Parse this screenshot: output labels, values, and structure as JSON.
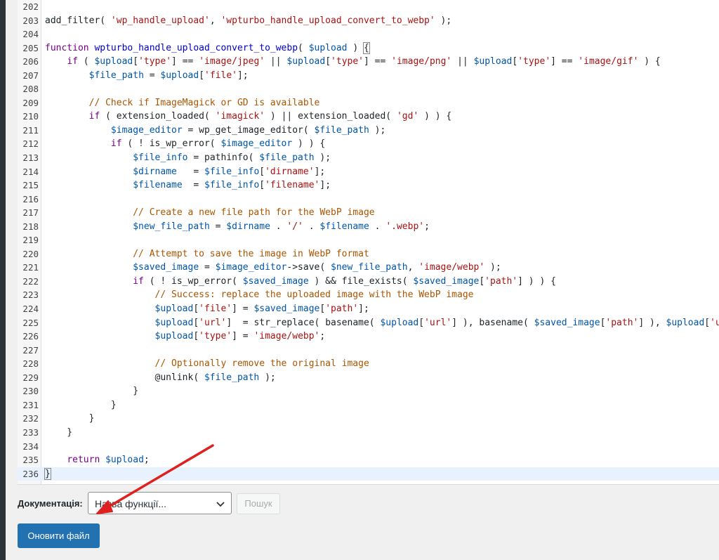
{
  "editor": {
    "lines": [
      {
        "n": "202",
        "tokens": []
      },
      {
        "n": "203",
        "tokens": [
          [
            "t-plain",
            "add_filter( "
          ],
          [
            "t-str",
            "'wp_handle_upload'"
          ],
          [
            "t-plain",
            ", "
          ],
          [
            "t-str",
            "'wpturbo_handle_upload_convert_to_webp'"
          ],
          [
            "t-plain",
            " );"
          ]
        ]
      },
      {
        "n": "204",
        "tokens": []
      },
      {
        "n": "205",
        "tokens": [
          [
            "t-kw",
            "function"
          ],
          [
            "t-plain",
            " "
          ],
          [
            "t-fn",
            "wpturbo_handle_upload_convert_to_webp"
          ],
          [
            "t-plain",
            "( "
          ],
          [
            "t-var",
            "$upload"
          ],
          [
            "t-plain",
            " ) "
          ],
          [
            "t-brace",
            "{"
          ]
        ]
      },
      {
        "n": "206",
        "tokens": [
          [
            "t-plain",
            "    "
          ],
          [
            "t-kw",
            "if"
          ],
          [
            "t-plain",
            " ( "
          ],
          [
            "t-var",
            "$upload"
          ],
          [
            "t-plain",
            "["
          ],
          [
            "t-str",
            "'type'"
          ],
          [
            "t-plain",
            "] == "
          ],
          [
            "t-str",
            "'image/jpeg'"
          ],
          [
            "t-plain",
            " || "
          ],
          [
            "t-var",
            "$upload"
          ],
          [
            "t-plain",
            "["
          ],
          [
            "t-str",
            "'type'"
          ],
          [
            "t-plain",
            "] == "
          ],
          [
            "t-str",
            "'image/png'"
          ],
          [
            "t-plain",
            " || "
          ],
          [
            "t-var",
            "$upload"
          ],
          [
            "t-plain",
            "["
          ],
          [
            "t-str",
            "'type'"
          ],
          [
            "t-plain",
            "] == "
          ],
          [
            "t-str",
            "'image/gif'"
          ],
          [
            "t-plain",
            " ) {"
          ]
        ]
      },
      {
        "n": "207",
        "tokens": [
          [
            "t-plain",
            "        "
          ],
          [
            "t-var",
            "$file_path"
          ],
          [
            "t-plain",
            " = "
          ],
          [
            "t-var",
            "$upload"
          ],
          [
            "t-plain",
            "["
          ],
          [
            "t-str",
            "'file'"
          ],
          [
            "t-plain",
            "];"
          ]
        ]
      },
      {
        "n": "208",
        "tokens": []
      },
      {
        "n": "209",
        "tokens": [
          [
            "t-plain",
            "        "
          ],
          [
            "t-com",
            "// Check if ImageMagick or GD is available"
          ]
        ]
      },
      {
        "n": "210",
        "tokens": [
          [
            "t-plain",
            "        "
          ],
          [
            "t-kw",
            "if"
          ],
          [
            "t-plain",
            " ( extension_loaded( "
          ],
          [
            "t-str",
            "'imagick'"
          ],
          [
            "t-plain",
            " ) || extension_loaded( "
          ],
          [
            "t-str",
            "'gd'"
          ],
          [
            "t-plain",
            " ) ) {"
          ]
        ]
      },
      {
        "n": "211",
        "tokens": [
          [
            "t-plain",
            "            "
          ],
          [
            "t-var",
            "$image_editor"
          ],
          [
            "t-plain",
            " = wp_get_image_editor( "
          ],
          [
            "t-var",
            "$file_path"
          ],
          [
            "t-plain",
            " );"
          ]
        ]
      },
      {
        "n": "212",
        "tokens": [
          [
            "t-plain",
            "            "
          ],
          [
            "t-kw",
            "if"
          ],
          [
            "t-plain",
            " ( ! is_wp_error( "
          ],
          [
            "t-var",
            "$image_editor"
          ],
          [
            "t-plain",
            " ) ) {"
          ]
        ]
      },
      {
        "n": "213",
        "tokens": [
          [
            "t-plain",
            "                "
          ],
          [
            "t-var",
            "$file_info"
          ],
          [
            "t-plain",
            " = pathinfo( "
          ],
          [
            "t-var",
            "$file_path"
          ],
          [
            "t-plain",
            " );"
          ]
        ]
      },
      {
        "n": "214",
        "tokens": [
          [
            "t-plain",
            "                "
          ],
          [
            "t-var",
            "$dirname"
          ],
          [
            "t-plain",
            "   = "
          ],
          [
            "t-var",
            "$file_info"
          ],
          [
            "t-plain",
            "["
          ],
          [
            "t-str",
            "'dirname'"
          ],
          [
            "t-plain",
            "];"
          ]
        ]
      },
      {
        "n": "215",
        "tokens": [
          [
            "t-plain",
            "                "
          ],
          [
            "t-var",
            "$filename"
          ],
          [
            "t-plain",
            "  = "
          ],
          [
            "t-var",
            "$file_info"
          ],
          [
            "t-plain",
            "["
          ],
          [
            "t-str",
            "'filename'"
          ],
          [
            "t-plain",
            "];"
          ]
        ]
      },
      {
        "n": "216",
        "tokens": []
      },
      {
        "n": "217",
        "tokens": [
          [
            "t-plain",
            "                "
          ],
          [
            "t-com",
            "// Create a new file path for the WebP image"
          ]
        ]
      },
      {
        "n": "218",
        "tokens": [
          [
            "t-plain",
            "                "
          ],
          [
            "t-var",
            "$new_file_path"
          ],
          [
            "t-plain",
            " = "
          ],
          [
            "t-var",
            "$dirname"
          ],
          [
            "t-plain",
            " . "
          ],
          [
            "t-str",
            "'/'"
          ],
          [
            "t-plain",
            " . "
          ],
          [
            "t-var",
            "$filename"
          ],
          [
            "t-plain",
            " . "
          ],
          [
            "t-str",
            "'.webp'"
          ],
          [
            "t-plain",
            ";"
          ]
        ]
      },
      {
        "n": "219",
        "tokens": []
      },
      {
        "n": "220",
        "tokens": [
          [
            "t-plain",
            "                "
          ],
          [
            "t-com",
            "// Attempt to save the image in WebP format"
          ]
        ]
      },
      {
        "n": "221",
        "tokens": [
          [
            "t-plain",
            "                "
          ],
          [
            "t-var",
            "$saved_image"
          ],
          [
            "t-plain",
            " = "
          ],
          [
            "t-var",
            "$image_editor"
          ],
          [
            "t-plain",
            "->save( "
          ],
          [
            "t-var",
            "$new_file_path"
          ],
          [
            "t-plain",
            ", "
          ],
          [
            "t-str",
            "'image/webp'"
          ],
          [
            "t-plain",
            " );"
          ]
        ]
      },
      {
        "n": "222",
        "tokens": [
          [
            "t-plain",
            "                "
          ],
          [
            "t-kw",
            "if"
          ],
          [
            "t-plain",
            " ( ! is_wp_error( "
          ],
          [
            "t-var",
            "$saved_image"
          ],
          [
            "t-plain",
            " ) && file_exists( "
          ],
          [
            "t-var",
            "$saved_image"
          ],
          [
            "t-plain",
            "["
          ],
          [
            "t-str",
            "'path'"
          ],
          [
            "t-plain",
            "] ) ) {"
          ]
        ]
      },
      {
        "n": "223",
        "tokens": [
          [
            "t-plain",
            "                    "
          ],
          [
            "t-com",
            "// Success: replace the uploaded image with the WebP image"
          ]
        ]
      },
      {
        "n": "224",
        "tokens": [
          [
            "t-plain",
            "                    "
          ],
          [
            "t-var",
            "$upload"
          ],
          [
            "t-plain",
            "["
          ],
          [
            "t-str",
            "'file'"
          ],
          [
            "t-plain",
            "] = "
          ],
          [
            "t-var",
            "$saved_image"
          ],
          [
            "t-plain",
            "["
          ],
          [
            "t-str",
            "'path'"
          ],
          [
            "t-plain",
            "];"
          ]
        ]
      },
      {
        "n": "225",
        "tokens": [
          [
            "t-plain",
            "                    "
          ],
          [
            "t-var",
            "$upload"
          ],
          [
            "t-plain",
            "["
          ],
          [
            "t-str",
            "'url'"
          ],
          [
            "t-plain",
            "]  = str_replace( basename( "
          ],
          [
            "t-var",
            "$upload"
          ],
          [
            "t-plain",
            "["
          ],
          [
            "t-str",
            "'url'"
          ],
          [
            "t-plain",
            "] ), basename( "
          ],
          [
            "t-var",
            "$saved_image"
          ],
          [
            "t-plain",
            "["
          ],
          [
            "t-str",
            "'path'"
          ],
          [
            "t-plain",
            "] ), "
          ],
          [
            "t-var",
            "$upload"
          ],
          [
            "t-plain",
            "["
          ],
          [
            "t-str",
            "'ur"
          ]
        ]
      },
      {
        "n": "226",
        "tokens": [
          [
            "t-plain",
            "                    "
          ],
          [
            "t-var",
            "$upload"
          ],
          [
            "t-plain",
            "["
          ],
          [
            "t-str",
            "'type'"
          ],
          [
            "t-plain",
            "] = "
          ],
          [
            "t-str",
            "'image/webp'"
          ],
          [
            "t-plain",
            ";"
          ]
        ]
      },
      {
        "n": "227",
        "tokens": []
      },
      {
        "n": "228",
        "tokens": [
          [
            "t-plain",
            "                    "
          ],
          [
            "t-com",
            "// Optionally remove the original image"
          ]
        ]
      },
      {
        "n": "229",
        "tokens": [
          [
            "t-plain",
            "                    @unlink( "
          ],
          [
            "t-var",
            "$file_path"
          ],
          [
            "t-plain",
            " );"
          ]
        ]
      },
      {
        "n": "230",
        "tokens": [
          [
            "t-plain",
            "                }"
          ]
        ]
      },
      {
        "n": "231",
        "tokens": [
          [
            "t-plain",
            "            }"
          ]
        ]
      },
      {
        "n": "232",
        "tokens": [
          [
            "t-plain",
            "        }"
          ]
        ]
      },
      {
        "n": "233",
        "tokens": [
          [
            "t-plain",
            "    }"
          ]
        ]
      },
      {
        "n": "234",
        "tokens": []
      },
      {
        "n": "235",
        "tokens": [
          [
            "t-plain",
            "    "
          ],
          [
            "t-kw",
            "return"
          ],
          [
            "t-plain",
            " "
          ],
          [
            "t-var",
            "$upload"
          ],
          [
            "t-plain",
            ";"
          ]
        ]
      },
      {
        "n": "236",
        "active": true,
        "tokens": [
          [
            "t-brace",
            "}"
          ]
        ]
      }
    ]
  },
  "documentation": {
    "label": "Документація:",
    "select_value": "Назва функції...",
    "lookup_label": "Пошук"
  },
  "actions": {
    "update_label": "Оновити файл"
  },
  "colors": {
    "primary": "#2271b1",
    "annotation_arrow": "#e0201e"
  }
}
